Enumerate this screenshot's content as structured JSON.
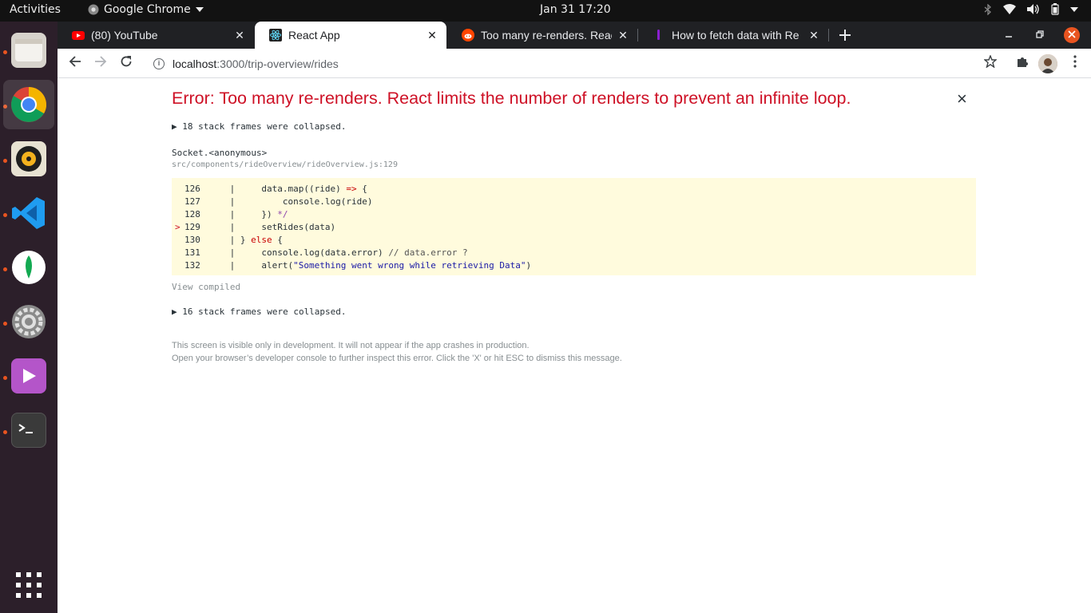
{
  "topbar": {
    "activities": "Activities",
    "app_name": "Google Chrome",
    "clock": "Jan 31  17:20"
  },
  "dock": {
    "items": [
      {
        "name": "files",
        "icon": "files-icon"
      },
      {
        "name": "chrome",
        "icon": "chrome-icon"
      },
      {
        "name": "rhythmbox",
        "icon": "rhythmbox-icon"
      },
      {
        "name": "vscode",
        "icon": "vscode-icon"
      },
      {
        "name": "mongodb-compass",
        "icon": "mongodb-icon"
      },
      {
        "name": "settings",
        "icon": "settings-icon"
      },
      {
        "name": "video-player",
        "icon": "video-player-icon"
      },
      {
        "name": "terminal",
        "icon": "terminal-icon"
      },
      {
        "name": "show-apps",
        "icon": "app-grid-icon"
      }
    ]
  },
  "tabs": [
    {
      "title": "(80) YouTube",
      "icon": "youtube-icon",
      "close": "✕"
    },
    {
      "title": "React App",
      "icon": "react-icon",
      "close": "✕"
    },
    {
      "title": "Too many re-renders. Reac",
      "icon": "reddit-icon",
      "close": "✕"
    },
    {
      "title": "How to fetch data with Re",
      "icon": "dev-icon",
      "close": "✕"
    }
  ],
  "toolbar": {
    "url_host": "localhost",
    "url_path": ":3000/trip-overview/rides"
  },
  "error": {
    "title": "Error: Too many re-renders. React limits the number of renders to prevent an infinite loop.",
    "close": "×",
    "collapsed_top": "▶ 18 stack frames were collapsed.",
    "frame_function": "Socket.<anonymous>",
    "frame_file": "src/components/rideOverview/rideOverview.js:129",
    "view_compiled": "View compiled",
    "collapsed_bottom": "▶ 16 stack frames were collapsed.",
    "footer_1": "This screen is visible only in development. It will not appear if the app crashes in production.",
    "footer_2": "Open your browser’s developer console to further inspect this error.  Click the 'X' or hit ESC to dismiss this message."
  },
  "code": {
    "lines": [
      {
        "marker": "",
        "number": "126",
        "sep": " |     ",
        "parts": [
          "data.map((ride) ",
          "=> ",
          "{"
        ]
      },
      {
        "marker": "",
        "number": "127",
        "sep": " |         ",
        "parts": [
          "console.log(ride)",
          "",
          ""
        ]
      },
      {
        "marker": "",
        "number": "128",
        "sep": " |     ",
        "parts": [
          "}) ",
          "*/",
          ""
        ]
      },
      {
        "marker": ">",
        "number": "129",
        "sep": " |     ",
        "parts": [
          "setRides(data)",
          "",
          ""
        ]
      },
      {
        "marker": "",
        "number": "130",
        "sep": " | ",
        "parts": [
          "} ",
          "else",
          " {"
        ]
      },
      {
        "marker": "",
        "number": "131",
        "sep": " |     ",
        "parts": [
          "console.log(data.error) ",
          "// data.error ?",
          ""
        ]
      },
      {
        "marker": "",
        "number": "132",
        "sep": " |     ",
        "parts": [
          "alert(",
          "\"Something went wrong while retrieving Data\"",
          ")"
        ]
      }
    ]
  }
}
